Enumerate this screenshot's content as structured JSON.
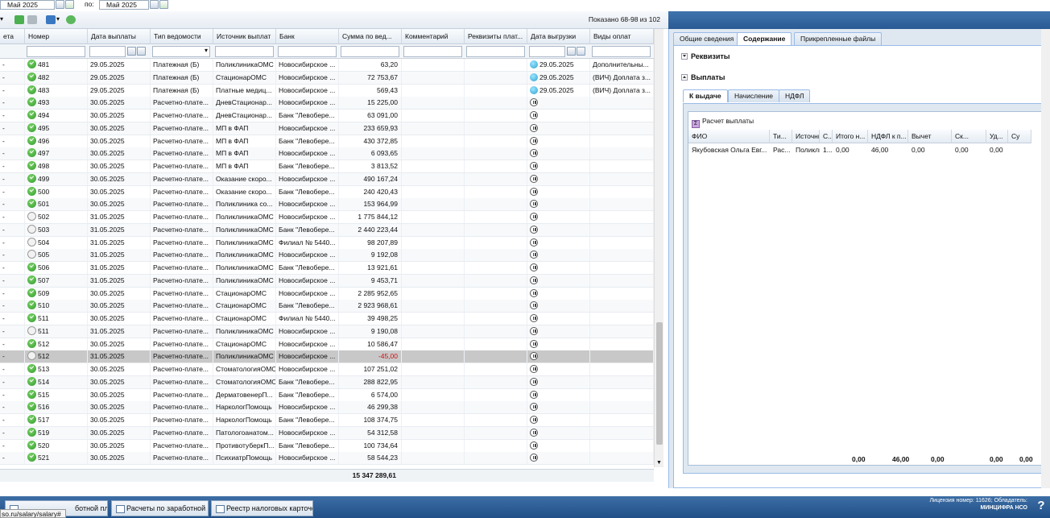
{
  "filter": {
    "from_value": "Май 2025",
    "to_label": "по:",
    "to_value": "Май 2025"
  },
  "toolbar": {
    "shown": "Показано 68-98 из 102"
  },
  "columns": [
    "ета",
    "Номер",
    "Дата выплаты",
    "Тип ведомости",
    "Источник выплат",
    "Банк",
    "Сумма по вед...",
    "Комментарий",
    "Реквизиты плат...",
    "Дата выгрузки",
    "Виды оплат"
  ],
  "rows": [
    {
      "s": "ok",
      "num": "481",
      "date": "29.05.2025",
      "type": "Платежная (Б)",
      "src": "ПоликлиникаОМС",
      "bank": "Новосибирское ...",
      "sum": "63,20",
      "exp": "up",
      "udate": "29.05.2025",
      "kinds": "Дополнительны..."
    },
    {
      "s": "ok",
      "num": "482",
      "date": "29.05.2025",
      "type": "Платежная (Б)",
      "src": "СтационарОМС",
      "bank": "Новосибирское ...",
      "sum": "72 753,67",
      "exp": "up",
      "udate": "29.05.2025",
      "kinds": "(ВИЧ) Доплата з..."
    },
    {
      "s": "ok",
      "num": "483",
      "date": "29.05.2025",
      "type": "Платежная (Б)",
      "src": "Платные медиц...",
      "bank": "Новосибирское ...",
      "sum": "569,43",
      "exp": "up",
      "udate": "29.05.2025",
      "kinds": "(ВИЧ) Доплата з..."
    },
    {
      "s": "ok",
      "num": "493",
      "date": "30.05.2025",
      "type": "Расчетно-плате...",
      "src": "ДневСтационар...",
      "bank": "Новосибирское ...",
      "sum": "15 225,00",
      "exp": "p",
      "udate": "",
      "kinds": ""
    },
    {
      "s": "ok",
      "num": "494",
      "date": "30.05.2025",
      "type": "Расчетно-плате...",
      "src": "ДневСтационар...",
      "bank": "Банк \"Левобере...",
      "sum": "63 091,00",
      "exp": "p",
      "udate": "",
      "kinds": ""
    },
    {
      "s": "ok",
      "num": "495",
      "date": "30.05.2025",
      "type": "Расчетно-плате...",
      "src": "МП в ФАП",
      "bank": "Новосибирское ...",
      "sum": "233 659,93",
      "exp": "p",
      "udate": "",
      "kinds": ""
    },
    {
      "s": "ok",
      "num": "496",
      "date": "30.05.2025",
      "type": "Расчетно-плате...",
      "src": "МП в ФАП",
      "bank": "Банк \"Левобере...",
      "sum": "430 372,85",
      "exp": "p",
      "udate": "",
      "kinds": ""
    },
    {
      "s": "ok",
      "num": "497",
      "date": "30.05.2025",
      "type": "Расчетно-плате...",
      "src": "МП в ФАП",
      "bank": "Новосибирское ...",
      "sum": "6 093,65",
      "exp": "p",
      "udate": "",
      "kinds": ""
    },
    {
      "s": "ok",
      "num": "498",
      "date": "30.05.2025",
      "type": "Расчетно-плате...",
      "src": "МП в ФАП",
      "bank": "Банк \"Левобере...",
      "sum": "3 813,52",
      "exp": "p",
      "udate": "",
      "kinds": ""
    },
    {
      "s": "ok",
      "num": "499",
      "date": "30.05.2025",
      "type": "Расчетно-плате...",
      "src": "Оказание скоро...",
      "bank": "Новосибирское ...",
      "sum": "490 167,24",
      "exp": "p",
      "udate": "",
      "kinds": ""
    },
    {
      "s": "ok",
      "num": "500",
      "date": "30.05.2025",
      "type": "Расчетно-плате...",
      "src": "Оказание скоро...",
      "bank": "Банк \"Левобере...",
      "sum": "240 420,43",
      "exp": "p",
      "udate": "",
      "kinds": ""
    },
    {
      "s": "ok",
      "num": "501",
      "date": "30.05.2025",
      "type": "Расчетно-плате...",
      "src": "Поликлиника со...",
      "bank": "Новосибирское ...",
      "sum": "153 964,99",
      "exp": "p",
      "udate": "",
      "kinds": ""
    },
    {
      "s": "w",
      "num": "502",
      "date": "31.05.2025",
      "type": "Расчетно-плате...",
      "src": "ПоликлиникаОМС",
      "bank": "Новосибирское ...",
      "sum": "1 775 844,12",
      "exp": "p",
      "udate": "",
      "kinds": ""
    },
    {
      "s": "w",
      "num": "503",
      "date": "31.05.2025",
      "type": "Расчетно-плате...",
      "src": "ПоликлиникаОМС",
      "bank": "Банк \"Левобере...",
      "sum": "2 440 223,44",
      "exp": "p",
      "udate": "",
      "kinds": ""
    },
    {
      "s": "w",
      "num": "504",
      "date": "31.05.2025",
      "type": "Расчетно-плате...",
      "src": "ПоликлиникаОМС",
      "bank": "Филиал № 5440...",
      "sum": "98 207,89",
      "exp": "p",
      "udate": "",
      "kinds": ""
    },
    {
      "s": "w",
      "num": "505",
      "date": "31.05.2025",
      "type": "Расчетно-плате...",
      "src": "ПоликлиникаОМС",
      "bank": "Новосибирское ...",
      "sum": "9 192,08",
      "exp": "p",
      "udate": "",
      "kinds": ""
    },
    {
      "s": "ok",
      "num": "506",
      "date": "31.05.2025",
      "type": "Расчетно-плате...",
      "src": "ПоликлиникаОМС",
      "bank": "Банк \"Левобере...",
      "sum": "13 921,61",
      "exp": "p",
      "udate": "",
      "kinds": ""
    },
    {
      "s": "ok",
      "num": "507",
      "date": "31.05.2025",
      "type": "Расчетно-плате...",
      "src": "ПоликлиникаОМС",
      "bank": "Новосибирское ...",
      "sum": "9 453,71",
      "exp": "p",
      "udate": "",
      "kinds": ""
    },
    {
      "s": "ok",
      "num": "509",
      "date": "30.05.2025",
      "type": "Расчетно-плате...",
      "src": "СтационарОМС",
      "bank": "Новосибирское ...",
      "sum": "2 285 952,65",
      "exp": "p",
      "udate": "",
      "kinds": ""
    },
    {
      "s": "ok",
      "num": "510",
      "date": "30.05.2025",
      "type": "Расчетно-плате...",
      "src": "СтационарОМС",
      "bank": "Банк \"Левобере...",
      "sum": "2 923 968,61",
      "exp": "p",
      "udate": "",
      "kinds": ""
    },
    {
      "s": "ok",
      "num": "511",
      "date": "30.05.2025",
      "type": "Расчетно-плате...",
      "src": "СтационарОМС",
      "bank": "Филиал № 5440...",
      "sum": "39 498,25",
      "exp": "p",
      "udate": "",
      "kinds": ""
    },
    {
      "s": "w",
      "num": "511",
      "date": "31.05.2025",
      "type": "Расчетно-плате...",
      "src": "ПоликлиникаОМС",
      "bank": "Новосибирское ...",
      "sum": "9 190,08",
      "exp": "p",
      "udate": "",
      "kinds": ""
    },
    {
      "s": "ok",
      "num": "512",
      "date": "30.05.2025",
      "type": "Расчетно-плате...",
      "src": "СтационарОМС",
      "bank": "Новосибирское ...",
      "sum": "10 586,47",
      "exp": "p",
      "udate": "",
      "kinds": ""
    },
    {
      "s": "w",
      "num": "512",
      "date": "31.05.2025",
      "type": "Расчетно-плате...",
      "src": "ПоликлиникаОМС",
      "bank": "Новосибирское ...",
      "sum": "-45,00",
      "exp": "p",
      "udate": "",
      "kinds": "",
      "sel": true,
      "neg": true
    },
    {
      "s": "ok",
      "num": "513",
      "date": "30.05.2025",
      "type": "Расчетно-плате...",
      "src": "СтоматологияОМС",
      "bank": "Новосибирское ...",
      "sum": "107 251,02",
      "exp": "p",
      "udate": "",
      "kinds": ""
    },
    {
      "s": "ok",
      "num": "514",
      "date": "30.05.2025",
      "type": "Расчетно-плате...",
      "src": "СтоматологияОМС",
      "bank": "Банк \"Левобере...",
      "sum": "288 822,95",
      "exp": "p",
      "udate": "",
      "kinds": ""
    },
    {
      "s": "ok",
      "num": "515",
      "date": "30.05.2025",
      "type": "Расчетно-плате...",
      "src": "ДерматовенерП...",
      "bank": "Банк \"Левобере...",
      "sum": "6 574,00",
      "exp": "p",
      "udate": "",
      "kinds": ""
    },
    {
      "s": "ok",
      "num": "516",
      "date": "30.05.2025",
      "type": "Расчетно-плате...",
      "src": "НаркологПомощь",
      "bank": "Новосибирское ...",
      "sum": "46 299,38",
      "exp": "p",
      "udate": "",
      "kinds": ""
    },
    {
      "s": "ok",
      "num": "517",
      "date": "30.05.2025",
      "type": "Расчетно-плате...",
      "src": "НаркологПомощь",
      "bank": "Банк \"Левобере...",
      "sum": "108 374,75",
      "exp": "p",
      "udate": "",
      "kinds": ""
    },
    {
      "s": "ok",
      "num": "519",
      "date": "30.05.2025",
      "type": "Расчетно-плате...",
      "src": "Патологоанатом...",
      "bank": "Новосибирское ...",
      "sum": "54 312,58",
      "exp": "p",
      "udate": "",
      "kinds": ""
    },
    {
      "s": "ok",
      "num": "520",
      "date": "30.05.2025",
      "type": "Расчетно-плате...",
      "src": "ПротивотуберкП...",
      "bank": "Банк \"Левобере...",
      "sum": "100 734,64",
      "exp": "p",
      "udate": "",
      "kinds": ""
    },
    {
      "s": "ok",
      "num": "521",
      "date": "30.05.2025",
      "type": "Расчетно-плате...",
      "src": "ПсихиатрПомощь",
      "bank": "Новосибирское ...",
      "sum": "58 544,23",
      "exp": "p",
      "udate": "",
      "kinds": ""
    }
  ],
  "total": "15 347 289,61",
  "right": {
    "tabs": [
      "Общие сведения",
      "Содержание",
      "Прикрепленные файлы"
    ],
    "sec_requisites": "Реквизиты",
    "sec_payments": "Выплаты",
    "subtabs": [
      "К выдаче",
      "Начисление",
      "НДФЛ"
    ],
    "calc_button": "Расчет выплаты",
    "cols": [
      "ФИО",
      "Ти...",
      "Источник",
      "С...",
      "Итого н...",
      "НДФЛ к п...",
      "Вычет",
      "Ск...",
      "Уд...",
      "Су"
    ],
    "row": [
      "Якубовская Ольга Евг...",
      "Рас...",
      "Поликли...",
      "1...",
      "0,00",
      "46,00",
      "0,00",
      "0,00",
      "0,00"
    ],
    "sums": [
      "0,00",
      "46,00",
      "0,00",
      "0,00",
      "0,00"
    ]
  },
  "taskbar": {
    "tasks": [
      "ботной платы",
      "Расчеты по заработной ...",
      "Реестр налоговых карточек"
    ],
    "license": "Лицензия номер: 11626; Обладатель:",
    "owner": "МИНЦИФРА НСО",
    "help": "?"
  },
  "status_url": "so.ru/salary/salary#"
}
